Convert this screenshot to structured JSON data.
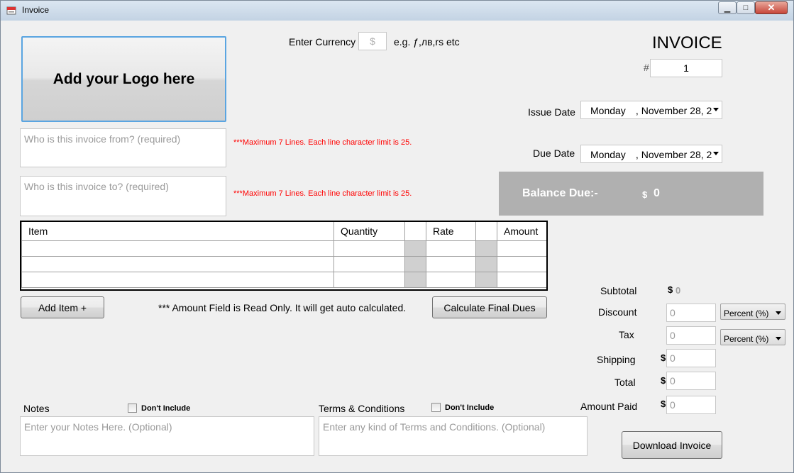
{
  "window": {
    "title": "Invoice",
    "minimize": "▁",
    "maximize": "□",
    "close": "✕"
  },
  "logo_button": "Add your Logo here",
  "currency": {
    "label": "Enter Currency",
    "placeholder": "$",
    "example": "e.g. ƒ,лв,rs etc"
  },
  "invoice": {
    "heading": "INVOICE",
    "hash": "#",
    "number": "1"
  },
  "from_placeholder": "Who is this  invoice from? (required)",
  "to_placeholder": "Who is this invoice to? (required)",
  "limit_note": "***Maximum 7 Lines. Each line character limit is 25.",
  "issue_date": {
    "label": "Issue Date",
    "day": "Monday",
    "sep": ",",
    "date": "November 28, 2"
  },
  "due_date": {
    "label": "Due Date",
    "day": "Monday",
    "sep": ",",
    "date": "November 28, 2"
  },
  "balance": {
    "label": "Balance Due:-",
    "currency": "$",
    "value": "0"
  },
  "table": {
    "headers": [
      "Item",
      "Quantity",
      "",
      "Rate",
      "",
      "Amount"
    ]
  },
  "add_item_button": "Add Item +",
  "readonly_note": "*** Amount Field is Read Only. It will get auto calculated.",
  "calculate_button": "Calculate Final Dues",
  "totals": {
    "subtotal_label": "Subtotal",
    "subtotal_currency": "$",
    "subtotal_value": "0",
    "discount_label": "Discount",
    "discount_value": "0",
    "discount_type": "Percent (%)",
    "tax_label": "Tax",
    "tax_value": "0",
    "tax_type": "Percent (%)",
    "shipping_label": "Shipping",
    "shipping_currency": "$",
    "shipping_value": "0",
    "total_label": "Total",
    "total_currency": "$",
    "total_value": "0",
    "paid_label": "Amount Paid",
    "paid_currency": "$",
    "paid_value": "0"
  },
  "notes": {
    "label": "Notes",
    "dont_include": "Don't Include",
    "placeholder": "Enter your Notes Here. (Optional)"
  },
  "terms": {
    "label": "Terms & Conditions",
    "dont_include": "Don't Include",
    "placeholder": "Enter any kind of Terms and Conditions. (Optional)"
  },
  "download_button": "Download Invoice"
}
